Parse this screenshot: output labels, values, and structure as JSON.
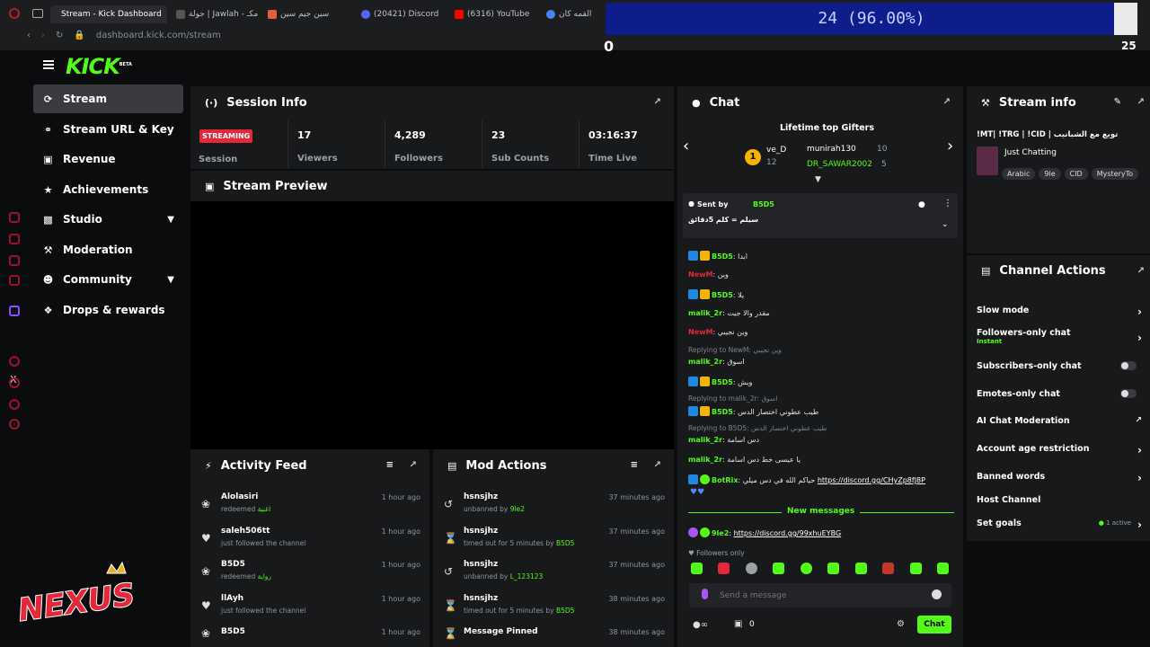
{
  "browser": {
    "tabs": [
      {
        "label": "Stream - Kick Dashboard",
        "color": "#53fc18"
      },
      {
        "label": "جولة | Jawlah - مكـ",
        "color": "#9aa0a6"
      },
      {
        "label": "سين جيم سين",
        "color": "#e0603a"
      },
      {
        "label": "(20421) Discord",
        "color": "#5865f2"
      },
      {
        "label": "(6316) YouTube",
        "color": "#ff0000"
      },
      {
        "label": "القمه كان",
        "color": "#4285f4"
      }
    ],
    "url": "dashboard.kick.com/stream"
  },
  "overlay": {
    "progress_text": "24 (96.00%)",
    "progress_fraction": 0.96,
    "counter_left": "0",
    "counter_right": "25"
  },
  "logo": {
    "text": "KICK",
    "tag": "BETA"
  },
  "sidebar": {
    "items": [
      {
        "label": "Stream",
        "icon": "broadcast-icon",
        "active": true
      },
      {
        "label": "Stream URL & Key",
        "icon": "link-icon"
      },
      {
        "label": "Revenue",
        "icon": "chart-icon"
      },
      {
        "label": "Achievements",
        "icon": "trophy-icon"
      },
      {
        "label": "Studio",
        "icon": "monitor-icon",
        "expandable": true
      },
      {
        "label": "Moderation",
        "icon": "wrench-icon"
      },
      {
        "label": "Community",
        "icon": "users-icon",
        "expandable": true
      },
      {
        "label": "Drops & rewards",
        "icon": "gift-icon"
      }
    ]
  },
  "session": {
    "title": "Session Info",
    "status_badge": "STREAMING",
    "status_label": "Session",
    "stats": [
      {
        "value": "17",
        "label": "Viewers"
      },
      {
        "value": "4,289",
        "label": "Followers"
      },
      {
        "value": "23",
        "label": "Sub Counts"
      },
      {
        "value": "03:16:37",
        "label": "Time Live"
      }
    ]
  },
  "preview": {
    "title": "Stream Preview"
  },
  "activity": {
    "title": "Activity Feed",
    "rows": [
      {
        "name": "Alolasiri",
        "action": "redeemed",
        "reward": "اغنية",
        "time": "1 hour ago",
        "icon": "reward-icon"
      },
      {
        "name": "saleh506tt",
        "action": "just followed the channel",
        "reward": "",
        "time": "1 hour ago",
        "icon": "heart-icon"
      },
      {
        "name": "B5D5",
        "action": "redeemed",
        "reward": "رواية",
        "time": "1 hour ago",
        "icon": "reward-icon"
      },
      {
        "name": "llAyh",
        "action": "just followed the channel",
        "reward": "",
        "time": "1 hour ago",
        "icon": "heart-icon"
      },
      {
        "name": "B5D5",
        "action": "",
        "reward": "",
        "time": "1 hour ago",
        "icon": "reward-icon"
      }
    ]
  },
  "mod": {
    "title": "Mod Actions",
    "rows": [
      {
        "name": "hsnsjhz",
        "action": "unbanned by",
        "by": "9le2",
        "time": "37 minutes ago",
        "icon": "undo-icon"
      },
      {
        "name": "hsnsjhz",
        "action": "timed out for 5 minutes by",
        "by": "B5D5",
        "time": "37 minutes ago",
        "icon": "hourglass-icon"
      },
      {
        "name": "hsnsjhz",
        "action": "unbanned by",
        "by": "L_123123",
        "time": "37 minutes ago",
        "icon": "undo-icon"
      },
      {
        "name": "hsnsjhz",
        "action": "timed out for 5 minutes by",
        "by": "B5D5",
        "time": "38 minutes ago",
        "icon": "hourglass-icon"
      },
      {
        "name": "Message Pinned",
        "action": "",
        "by": "",
        "time": "38 minutes ago",
        "icon": "hourglass-icon"
      }
    ]
  },
  "chat": {
    "title": "Chat",
    "gifters_title": "Lifetime top Gifters",
    "gifters": [
      {
        "rank": "1",
        "name": "ve_D",
        "count": ""
      },
      {
        "rank": "",
        "name": "munirah130",
        "count": "10"
      },
      {
        "rank": "",
        "name": "",
        "count": "12"
      },
      {
        "rank": "",
        "name": "DR_SAWAR2002",
        "count": "5"
      }
    ],
    "pinned": {
      "prefix": "Sent by",
      "user": "B5D5",
      "text": "سيلم = كلم 5دقائق"
    },
    "messages": [
      {
        "user": "B5D5",
        "color": "#53fc18",
        "text": ": ابدا",
        "badges": true
      },
      {
        "user": "NewM",
        "color": "#e3283a",
        "text": ": وين",
        "badges": false
      },
      {
        "user": "B5D5",
        "color": "#53fc18",
        "text": ": يلا",
        "badges": true
      },
      {
        "user": "malik_2r",
        "color": "#53fc18",
        "text": ": مقدر والا جيت",
        "badges": false
      },
      {
        "user": "NewM",
        "color": "#e3283a",
        "text": ": وين نجيبي",
        "badges": false
      },
      {
        "user": "malik_2r",
        "color": "#53fc18",
        "text": ": اسوق",
        "badges": false,
        "reply": "Replying to NewM: وين نجيبي"
      },
      {
        "user": "B5D5",
        "color": "#53fc18",
        "text": ": ويش",
        "badges": true
      },
      {
        "user": "B5D5",
        "color": "#53fc18",
        "text": ": طيب عطوني اختصار الدس",
        "badges": true,
        "reply": "Replying to malik_2r: اسوق"
      },
      {
        "user": "malik_2r",
        "color": "#53fc18",
        "text": ": دس اسامة",
        "badges": false,
        "reply": "Replying to B5D5: طيب عطوني اختصار الدس"
      },
      {
        "user": "malik_2r",
        "color": "#53fc18",
        "text": ": يا عيسى خط دس اسامة",
        "badges": false
      },
      {
        "user": "BotRix",
        "color": "#53fc18",
        "text": ": حياكم الله في دس ميلي",
        "link": "https://discord.gg/CHyZp8fJ8P",
        "badges": true
      }
    ],
    "new_messages": "New messages",
    "last": {
      "user": "9le2",
      "link": "https://discord.gg/99xhuEYBG"
    },
    "followers_only": "Followers only",
    "input_placeholder": "Send a message",
    "send_label": "Chat",
    "bottom_count": "0"
  },
  "stream_info": {
    "title": "Stream info",
    "stream_title": "!MT| !TRG | !CID | تويع مع الشبانيب",
    "category": "Just Chatting",
    "tags": [
      "Arabic",
      "9le",
      "CID",
      "MysteryTo"
    ]
  },
  "channel_actions": {
    "title": "Channel Actions",
    "items": [
      {
        "label": "Slow mode",
        "kind": "arrow"
      },
      {
        "label": "Followers-only chat",
        "sub": "Instant",
        "kind": "arrow"
      },
      {
        "label": "Subscribers-only chat",
        "kind": "toggle"
      },
      {
        "label": "Emotes-only chat",
        "kind": "toggle"
      },
      {
        "label": "AI Chat Moderation",
        "kind": "external"
      },
      {
        "label": "Account age restriction",
        "kind": "arrow"
      },
      {
        "label": "Banned words",
        "kind": "arrow"
      },
      {
        "label": "Host Channel",
        "kind": "none"
      },
      {
        "label": "Set goals",
        "sub_right": "1 active",
        "kind": "arrow"
      }
    ]
  },
  "watermark": {
    "text": "NEXUS"
  },
  "colors": {
    "accent": "#53fc18",
    "live": "#e3283a",
    "panel": "#18191b",
    "bg": "#0b0c0d"
  }
}
